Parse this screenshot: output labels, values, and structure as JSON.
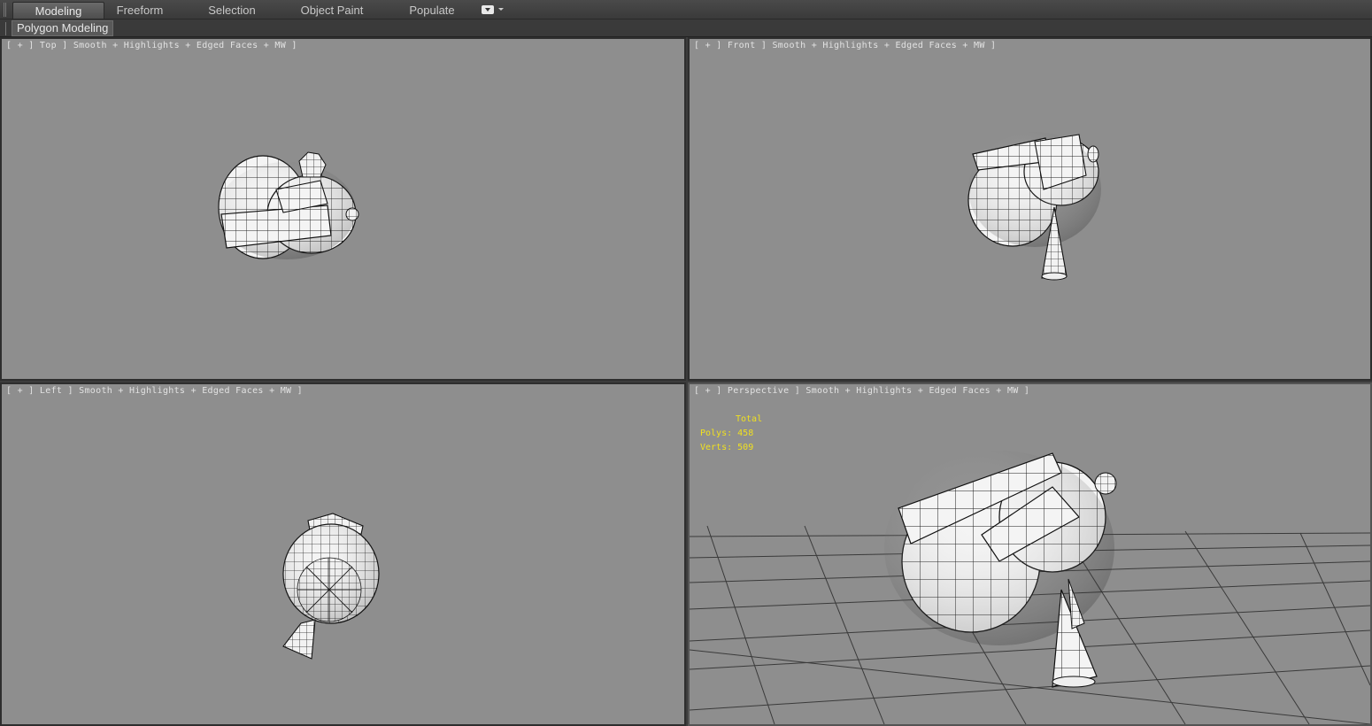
{
  "ribbon": {
    "tabs": [
      {
        "label": "Modeling",
        "active": true
      },
      {
        "label": "Freeform",
        "active": false
      },
      {
        "label": "Selection",
        "active": false
      },
      {
        "label": "Object Paint",
        "active": false
      },
      {
        "label": "Populate",
        "active": false
      }
    ],
    "dropdown_icon": "ribbon-options-icon"
  },
  "subbar": {
    "panel_label": "Polygon Modeling"
  },
  "viewports": {
    "top": {
      "label": "[ + ] Top ] Smooth + Highlights + Edged Faces + MW ]"
    },
    "front": {
      "label": "[ + ] Front ] Smooth + Highlights + Edged Faces + MW ]"
    },
    "left": {
      "label": "[ + ] Left ] Smooth + Highlights + Edged Faces + MW ]"
    },
    "perspective": {
      "label": "[ + ] Perspective ] Smooth + Highlights + Edged Faces + MW ]",
      "stats": {
        "total_label": "Total",
        "polys_label": "Polys:",
        "polys_value": "458",
        "verts_label": "Verts:",
        "verts_value": "509"
      }
    }
  },
  "colors": {
    "viewport_bg": "#8e8e8e",
    "stats_text": "#f0e020",
    "active_tab": "#5e5e5e"
  }
}
